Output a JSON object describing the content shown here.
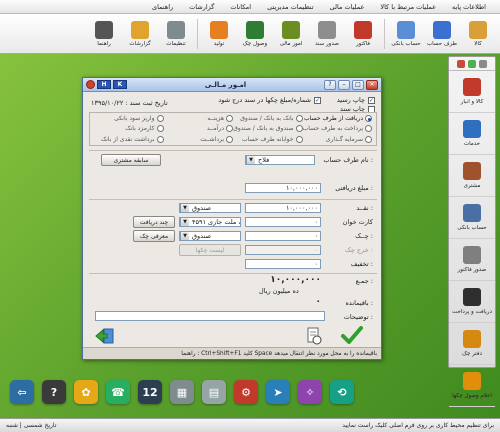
{
  "menu": [
    "اطلاعات پایه",
    "عملیات مرتبط با کالا",
    "عملیات مالی",
    "تنظیمات مدیریتی",
    "امکانات",
    "گزارشات",
    "راهنمای"
  ],
  "toolbar": [
    {
      "label": "کالا",
      "color": "#d9a03a"
    },
    {
      "label": "طرف حساب",
      "color": "#3b6fd1"
    },
    {
      "label": "حساب بانکی",
      "color": "#5a8fd6"
    },
    {
      "label": "فاکتور",
      "color": "#c0392b"
    },
    {
      "label": "صدور سند",
      "color": "#8e8e8e"
    },
    {
      "label": "امور مالی",
      "color": "#6b8e23"
    },
    {
      "label": "وصول چک",
      "color": "#2e7d32"
    },
    {
      "label": "تولید",
      "color": "#e67e22"
    },
    {
      "label": "تنظیمات",
      "color": "#7f8c8d"
    },
    {
      "label": "گزارشات",
      "color": "#e0a32e"
    },
    {
      "label": "راهنما",
      "color": "#555555"
    }
  ],
  "sidebar": [
    {
      "label": "کالا و انبار",
      "color": "#c0392b"
    },
    {
      "label": "خدمات",
      "color": "#2f6fbf"
    },
    {
      "label": "مشتری",
      "color": "#a0522d"
    },
    {
      "label": "حساب بانکی",
      "color": "#4a6fa5"
    },
    {
      "label": "صدور فاکتور",
      "color": "#7f7f7f"
    },
    {
      "label": "دریافت و پرداخت",
      "color": "#2f2f2f"
    },
    {
      "label": "دفتر چک",
      "color": "#d68910"
    },
    {
      "label": "اعلام وصول چکها",
      "color": "#e08e0b"
    }
  ],
  "dock": [
    {
      "glyph": "⇦",
      "color": "#2e6da4"
    },
    {
      "glyph": "?",
      "color": "#3a3a3a"
    },
    {
      "glyph": "✿",
      "color": "#e6a817"
    },
    {
      "glyph": "☎",
      "color": "#27ae60"
    },
    {
      "glyph": "12",
      "color": "#2c3e50"
    },
    {
      "glyph": "▦",
      "color": "#7f8c8d"
    },
    {
      "glyph": "▤",
      "color": "#95a5a6"
    },
    {
      "glyph": "⚙",
      "color": "#c0392b"
    },
    {
      "glyph": "➤",
      "color": "#2980b9"
    },
    {
      "glyph": "✧",
      "color": "#8e44ad"
    },
    {
      "glyph": "⟲",
      "color": "#16a085"
    }
  ],
  "statusbar": {
    "left": "تاریخ شمسی | شنبه",
    "right": "برای تنظیم محیط کاری بر روی فرم اصلی کلیک راست نمایید"
  },
  "dialog": {
    "title": "امـور مـالـی",
    "hotkeys": [
      "H",
      "K"
    ],
    "check_print_receipt": "چاپ رسید",
    "check_number_in_doc": "شماره/مبلغ چکها در سند درج شود",
    "check_print_doc": "چاپ سند",
    "doc_date": "تاریخ ثبت سند : ۱۳۹۵/۱۰/۲۲",
    "radios": [
      {
        "label": "دریافت از طرف حساب",
        "on": true
      },
      {
        "label": "بانک به بانک / صندوق",
        "on": false
      },
      {
        "label": "هزینــه",
        "on": false
      },
      {
        "label": "واریز سود بانکی",
        "on": false
      },
      {
        "label": "پرداخت به طرف حساب",
        "on": false
      },
      {
        "label": "صندوق به بانک / صندوق",
        "on": false
      },
      {
        "label": "درآمــد",
        "on": false
      },
      {
        "label": "کارمزد بانک",
        "on": false
      },
      {
        "label": "سرمایه گـذاری",
        "on": false
      },
      {
        "label": "خوابانه طرف حساب",
        "on": false
      },
      {
        "label": "برداشــت",
        "on": false
      },
      {
        "label": "برداشت نقدی از بانک",
        "on": false
      }
    ],
    "account_name_label": "نام طرف حساب :",
    "account_value": "فلاح",
    "history_button": "سابقه مشتری",
    "amount_label": "مبلغ دریافتی :",
    "amount_value": "۱۰,۰۰۰,۰۰۰",
    "cash_label": "نقــد :",
    "cash_value": "۱۰,۰۰۰,۰۰۰",
    "cash_source": "صندوق",
    "cardreader_label": "کارت خوان",
    "cardreader_value": "۰",
    "cardreader_bank": "بانک ملت جاری ۴۵۹۱",
    "multi_receipt_button": "چند دریافت",
    "cheque_label": "چــک :",
    "cheque_value": "۰",
    "cheque_source": "صندوق",
    "introduce_cheque_button": "معرفی چک",
    "out_cheque_label": "خرج چک :",
    "out_cheque_value": "۰",
    "cheque_list_button": "لیست چکها",
    "discount_label": "تخفیف :",
    "discount_value": "۰",
    "total_label": "جمـع :",
    "total_value": "۱۰,۰۰۰,۰۰۰",
    "total_words": "ده میلیون ریال",
    "remaining_label": "باقیمانده :",
    "remaining_value": "۰",
    "description_label": "توضیحات :",
    "description_value": "",
    "status": "راهنما : Ctrl+Shift+F1 کلید Space باقیمانده را به محل مورد نظر انتقال میدهد"
  }
}
